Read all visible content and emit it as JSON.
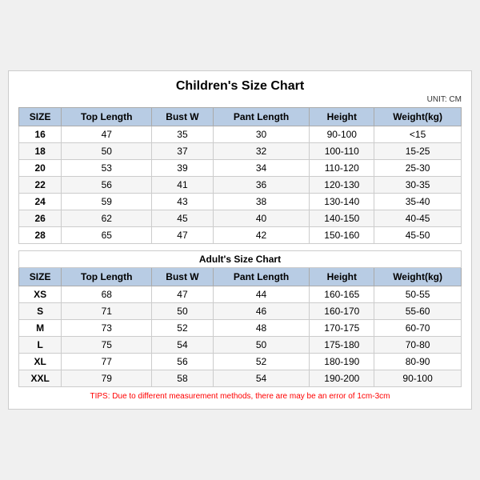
{
  "title": "Children's Size Chart",
  "unit": "UNIT: CM",
  "children_headers": [
    "SIZE",
    "Top Length",
    "Bust W",
    "Pant Length",
    "Height",
    "Weight(kg)"
  ],
  "children_rows": [
    [
      "16",
      "47",
      "35",
      "30",
      "90-100",
      "<15"
    ],
    [
      "18",
      "50",
      "37",
      "32",
      "100-110",
      "15-25"
    ],
    [
      "20",
      "53",
      "39",
      "34",
      "110-120",
      "25-30"
    ],
    [
      "22",
      "56",
      "41",
      "36",
      "120-130",
      "30-35"
    ],
    [
      "24",
      "59",
      "43",
      "38",
      "130-140",
      "35-40"
    ],
    [
      "26",
      "62",
      "45",
      "40",
      "140-150",
      "40-45"
    ],
    [
      "28",
      "65",
      "47",
      "42",
      "150-160",
      "45-50"
    ]
  ],
  "adults_title": "Adult's Size Chart",
  "adults_headers": [
    "SIZE",
    "Top Length",
    "Bust W",
    "Pant Length",
    "Height",
    "Weight(kg)"
  ],
  "adults_rows": [
    [
      "XS",
      "68",
      "47",
      "44",
      "160-165",
      "50-55"
    ],
    [
      "S",
      "71",
      "50",
      "46",
      "160-170",
      "55-60"
    ],
    [
      "M",
      "73",
      "52",
      "48",
      "170-175",
      "60-70"
    ],
    [
      "L",
      "75",
      "54",
      "50",
      "175-180",
      "70-80"
    ],
    [
      "XL",
      "77",
      "56",
      "52",
      "180-190",
      "80-90"
    ],
    [
      "XXL",
      "79",
      "58",
      "54",
      "190-200",
      "90-100"
    ]
  ],
  "tips": "TIPS: Due to different measurement methods, there are may be an error of 1cm-3cm"
}
